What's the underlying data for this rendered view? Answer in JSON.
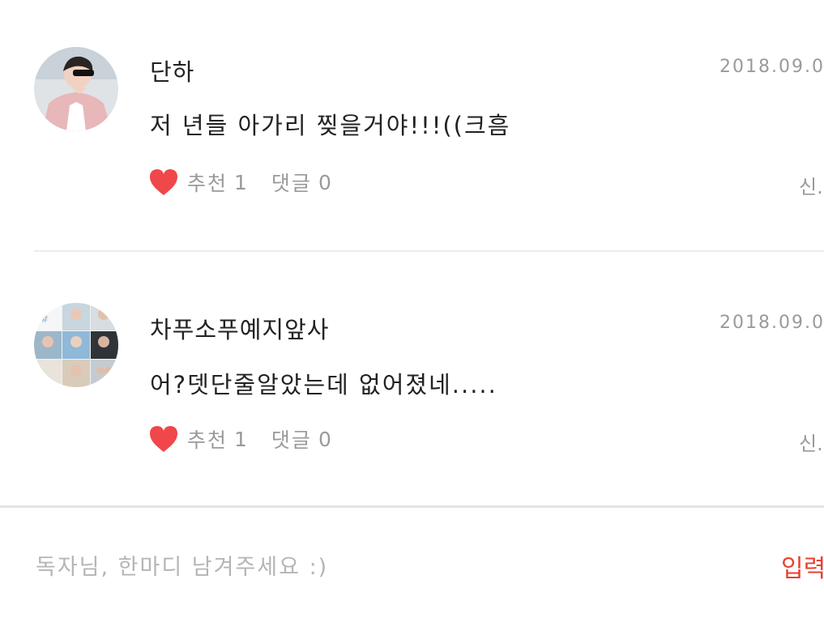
{
  "comments": [
    {
      "author": "단하",
      "date": "2018.09.0",
      "text": "저 년들 아가리 찢을거야!!!((크흠",
      "like_label": "추천",
      "like_count": "1",
      "reply_label": "댓글",
      "reply_count": "0",
      "report_label": "신."
    },
    {
      "author": "차푸소푸예지앞사",
      "date": "2018.09.0",
      "text": "어?뎃단줄알았는데 없어졌네.....",
      "like_label": "추천",
      "like_count": "1",
      "reply_label": "댓글",
      "reply_count": "0",
      "report_label": "신."
    }
  ],
  "input": {
    "placeholder": "독자님, 한마디 남겨주세요 :)",
    "submit_label": "입력"
  },
  "colors": {
    "heart": "#f0474a",
    "submit": "#e8412f",
    "muted_text": "#9a9a9a",
    "body_text": "#222222"
  }
}
